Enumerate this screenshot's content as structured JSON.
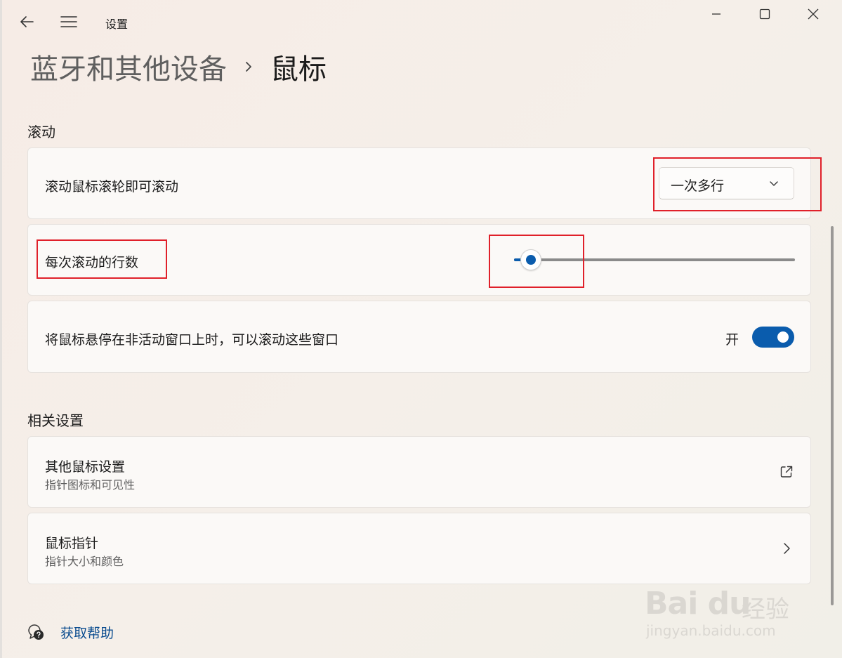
{
  "window": {
    "app_title": "设置",
    "icons": {
      "back": "back-arrow-icon",
      "menu": "hamburger-menu-icon",
      "minimize": "minimize-icon",
      "maximize": "maximize-icon",
      "close": "close-icon"
    }
  },
  "breadcrumb": {
    "parent": "蓝牙和其他设备",
    "current": "鼠标"
  },
  "scrolling": {
    "title": "滚动",
    "wheel": {
      "label": "滚动鼠标滚轮即可滚动",
      "selected": "一次多行"
    },
    "lines": {
      "label": "每次滚动的行数",
      "slider_fraction": 0.05
    },
    "inactive": {
      "label": "将鼠标悬停在非活动窗口上时，可以滚动这些窗口",
      "state": "开"
    }
  },
  "related": {
    "title": "相关设置",
    "items": [
      {
        "title": "其他鼠标设置",
        "subtitle": "指针图标和可见性",
        "icon": "external-link-icon"
      },
      {
        "title": "鼠标指针",
        "subtitle": "指针大小和颜色",
        "icon": "chevron-right-icon"
      }
    ]
  },
  "help": {
    "label": "获取帮助",
    "icon": "help-chat-icon"
  },
  "watermark": {
    "logo": "Bai du",
    "logo2": "经验",
    "url": "jingyan.baidu.com"
  },
  "colors": {
    "accent": "#0a5cad",
    "highlight_box": "#e0202a",
    "link": "#0a4c8f"
  }
}
